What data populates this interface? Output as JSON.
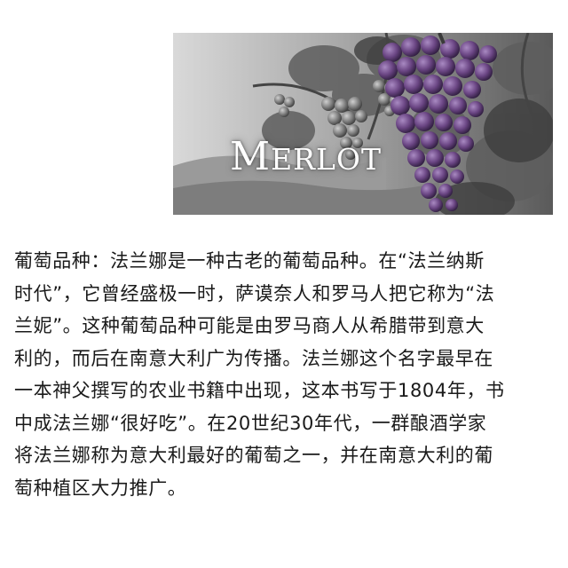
{
  "hero": {
    "title_initial": "M",
    "title_rest": "ERLOT",
    "image_icon": "grape-vineyard-photo-icon"
  },
  "body": {
    "lines": [
      "葡萄品种：法兰娜是一种古老的葡萄品种。在“法兰纳斯",
      "时代”，它曾经盛极一时，萨谟奈人和罗马人把它称为“法",
      "兰妮”。这种葡萄品种可能是由罗马商人从希腊带到意大",
      "利的，而后在南意大利广为传播。法兰娜这个名字最早在",
      "一本神父撰写的农业书籍中出现，这本书写于1804年，书",
      "中成法兰娜“很好吃”。在20世纪30年代，一群酿酒学家",
      "将法兰娜称为意大利最好的葡萄之一，并在南意大利的葡",
      "萄种植区大力推广。"
    ]
  },
  "colors": {
    "grape_purple": "#6e4a86",
    "photo_gray": "#8a8a8a",
    "text": "#1a1a1a"
  }
}
